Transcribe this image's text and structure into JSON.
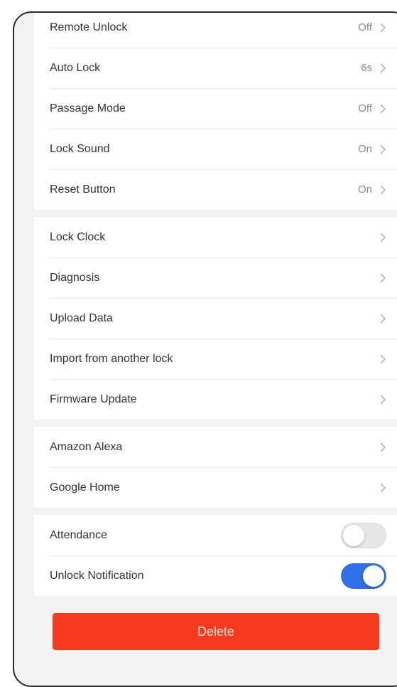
{
  "settings_group_1": [
    {
      "label": "Remote Unlock",
      "value": "Off"
    },
    {
      "label": "Auto Lock",
      "value": "6s"
    },
    {
      "label": "Passage Mode",
      "value": "Off"
    },
    {
      "label": "Lock Sound",
      "value": "On"
    },
    {
      "label": "Reset Button",
      "value": "On"
    }
  ],
  "settings_group_2": [
    {
      "label": "Lock Clock"
    },
    {
      "label": "Diagnosis"
    },
    {
      "label": "Upload Data"
    },
    {
      "label": "Import from another lock"
    },
    {
      "label": "Firmware Update"
    }
  ],
  "settings_group_3": [
    {
      "label": "Amazon Alexa"
    },
    {
      "label": "Google Home"
    }
  ],
  "settings_group_4": [
    {
      "label": "Attendance",
      "toggle": "off"
    },
    {
      "label": "Unlock Notification",
      "toggle": "on"
    }
  ],
  "delete_button": {
    "label": "Delete"
  },
  "icons": {
    "chevron": "chevron-right-icon"
  },
  "colors": {
    "accent_blue": "#2f6fe8",
    "danger_red": "#f7391d"
  }
}
